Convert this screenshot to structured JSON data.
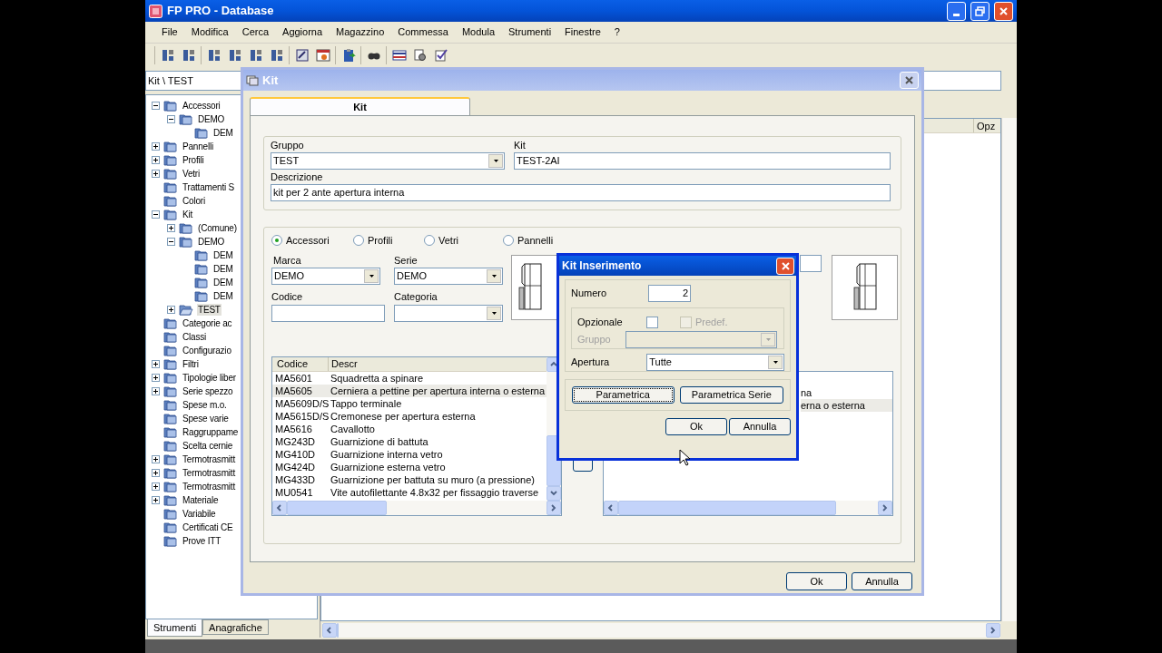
{
  "app": {
    "title": "FP PRO - Database"
  },
  "menu": [
    "File",
    "Modifica",
    "Cerca",
    "Aggiorna",
    "Magazzino",
    "Commessa",
    "Modula",
    "Strumenti",
    "Finestre",
    "?"
  ],
  "path": "Kit \\ TEST",
  "tree": [
    {
      "label": "Accessori",
      "kind": "branch",
      "expanded": true,
      "selected": false,
      "children": [
        {
          "label": "DEMO",
          "kind": "branch",
          "expanded": true,
          "selected": false,
          "children": [
            {
              "label": "DEM",
              "kind": "leaf",
              "selected": false
            }
          ]
        }
      ]
    },
    {
      "label": "Pannelli",
      "kind": "branch",
      "expanded": false,
      "selected": false
    },
    {
      "label": "Profili",
      "kind": "branch",
      "expanded": false,
      "selected": false
    },
    {
      "label": "Vetri",
      "kind": "branch",
      "expanded": false,
      "selected": false
    },
    {
      "label": "Trattamenti S",
      "kind": "leaf",
      "selected": false
    },
    {
      "label": "Colori",
      "kind": "leaf",
      "selected": false
    },
    {
      "label": "Kit",
      "kind": "branch",
      "expanded": true,
      "selected": false,
      "children": [
        {
          "label": "(Comune)",
          "kind": "branch",
          "expanded": false,
          "selected": false
        },
        {
          "label": "DEMO",
          "kind": "branch",
          "expanded": true,
          "selected": false,
          "children": [
            {
              "label": "DEM",
              "kind": "leaf",
              "selected": false
            },
            {
              "label": "DEM",
              "kind": "leaf",
              "selected": false
            },
            {
              "label": "DEM",
              "kind": "leaf",
              "selected": false
            },
            {
              "label": "DEM",
              "kind": "leaf",
              "selected": false
            }
          ]
        },
        {
          "label": "TEST",
          "kind": "branch",
          "expanded": false,
          "selected": true
        }
      ]
    },
    {
      "label": "Categorie ac",
      "kind": "leaf",
      "selected": false
    },
    {
      "label": "Classi",
      "kind": "leaf",
      "selected": false
    },
    {
      "label": "Configurazio",
      "kind": "leaf",
      "selected": false
    },
    {
      "label": "Filtri",
      "kind": "branch",
      "expanded": false,
      "selected": false
    },
    {
      "label": "Tipologie liber",
      "kind": "branch",
      "expanded": false,
      "selected": false
    },
    {
      "label": "Serie spezzo",
      "kind": "branch",
      "expanded": false,
      "selected": false
    },
    {
      "label": "Spese m.o.",
      "kind": "leaf",
      "selected": false
    },
    {
      "label": "Spese varie",
      "kind": "leaf",
      "selected": false
    },
    {
      "label": "Raggruppame",
      "kind": "leaf",
      "selected": false
    },
    {
      "label": "Scelta cernie",
      "kind": "leaf",
      "selected": false
    },
    {
      "label": "Termotrasmitt",
      "kind": "branch",
      "expanded": false,
      "selected": false
    },
    {
      "label": "Termotrasmitt",
      "kind": "branch",
      "expanded": false,
      "selected": false
    },
    {
      "label": "Termotrasmitt",
      "kind": "branch",
      "expanded": false,
      "selected": false
    },
    {
      "label": "Materiale",
      "kind": "branch",
      "expanded": false,
      "selected": false
    },
    {
      "label": "Variabile",
      "kind": "leaf",
      "selected": false
    },
    {
      "label": "Certificati CE",
      "kind": "leaf",
      "selected": false
    },
    {
      "label": "Prove ITT",
      "kind": "leaf",
      "selected": false
    }
  ],
  "left_tabs": [
    {
      "label": "Strumenti",
      "selected": true
    },
    {
      "label": "Anagrafiche",
      "selected": false
    }
  ],
  "main_table": {
    "columns": [
      "Opz"
    ]
  },
  "kit_dialog": {
    "title": "Kit",
    "tab": {
      "label": "Kit",
      "selected": true
    },
    "gruppo": {
      "label": "Gruppo",
      "value": "TEST"
    },
    "kit": {
      "label": "Kit",
      "value": "TEST-2AI"
    },
    "descrizione": {
      "label": "Descrizione",
      "value": "kit per 2 ante apertura interna"
    },
    "types": [
      {
        "label": "Accessori",
        "selected": true
      },
      {
        "label": "Profili",
        "selected": false
      },
      {
        "label": "Vetri",
        "selected": false
      },
      {
        "label": "Pannelli",
        "selected": false
      }
    ],
    "marca": {
      "label": "Marca",
      "value": "DEMO"
    },
    "serie": {
      "label": "Serie",
      "value": "DEMO"
    },
    "codice": {
      "label": "Codice"
    },
    "categoria": {
      "label": "Categoria"
    },
    "list": {
      "columns": [
        "Codice",
        "Descr"
      ],
      "rows": [
        {
          "cells": [
            "MA5601",
            "Squadretta a spinare"
          ],
          "selected": false
        },
        {
          "cells": [
            "MA5605",
            "Cerniera a pettine per apertura interna o esterna"
          ],
          "selected": true
        },
        {
          "cells": [
            "MA5609D/S",
            "Tappo terminale"
          ],
          "selected": false
        },
        {
          "cells": [
            "MA5615D/S",
            "Cremonese per apertura esterna"
          ],
          "selected": false
        },
        {
          "cells": [
            "MA5616",
            "Cavallotto"
          ],
          "selected": false
        },
        {
          "cells": [
            "MG243D",
            "Guarnizione di battuta"
          ],
          "selected": false
        },
        {
          "cells": [
            "MG410D",
            "Guarnizione interna vetro"
          ],
          "selected": false
        },
        {
          "cells": [
            "MG424D",
            "Guarnizione esterna vetro"
          ],
          "selected": false
        },
        {
          "cells": [
            "MG433D",
            "Guarnizione per battuta su muro (a pressione)"
          ],
          "selected": false
        },
        {
          "cells": [
            "MU0541",
            "Vite autofilettante 4.8x32 per fissaggio traverse"
          ],
          "selected": false
        }
      ]
    },
    "right_list": {
      "rows": [
        {
          "text": "na",
          "selected": false
        },
        {
          "text": "erna o esterna",
          "selected": true
        }
      ]
    },
    "buttons": [
      "Ok",
      "Annulla"
    ]
  },
  "insert_dialog": {
    "title": "Kit Inserimento",
    "numero": {
      "label": "Numero",
      "value": "2"
    },
    "opzionale": {
      "label": "Opzionale",
      "checked": false
    },
    "predef": {
      "label": "Predef.",
      "checked": false,
      "disabled": true
    },
    "gruppo": {
      "label": "Gruppo",
      "disabled": true
    },
    "apertura": {
      "label": "Apertura",
      "value": "Tutte"
    },
    "param_buttons": [
      {
        "label": "Parametrica",
        "focused": true
      },
      {
        "label": "Parametrica Serie",
        "focused": false
      }
    ],
    "buttons": [
      "Ok",
      "Annulla"
    ]
  }
}
